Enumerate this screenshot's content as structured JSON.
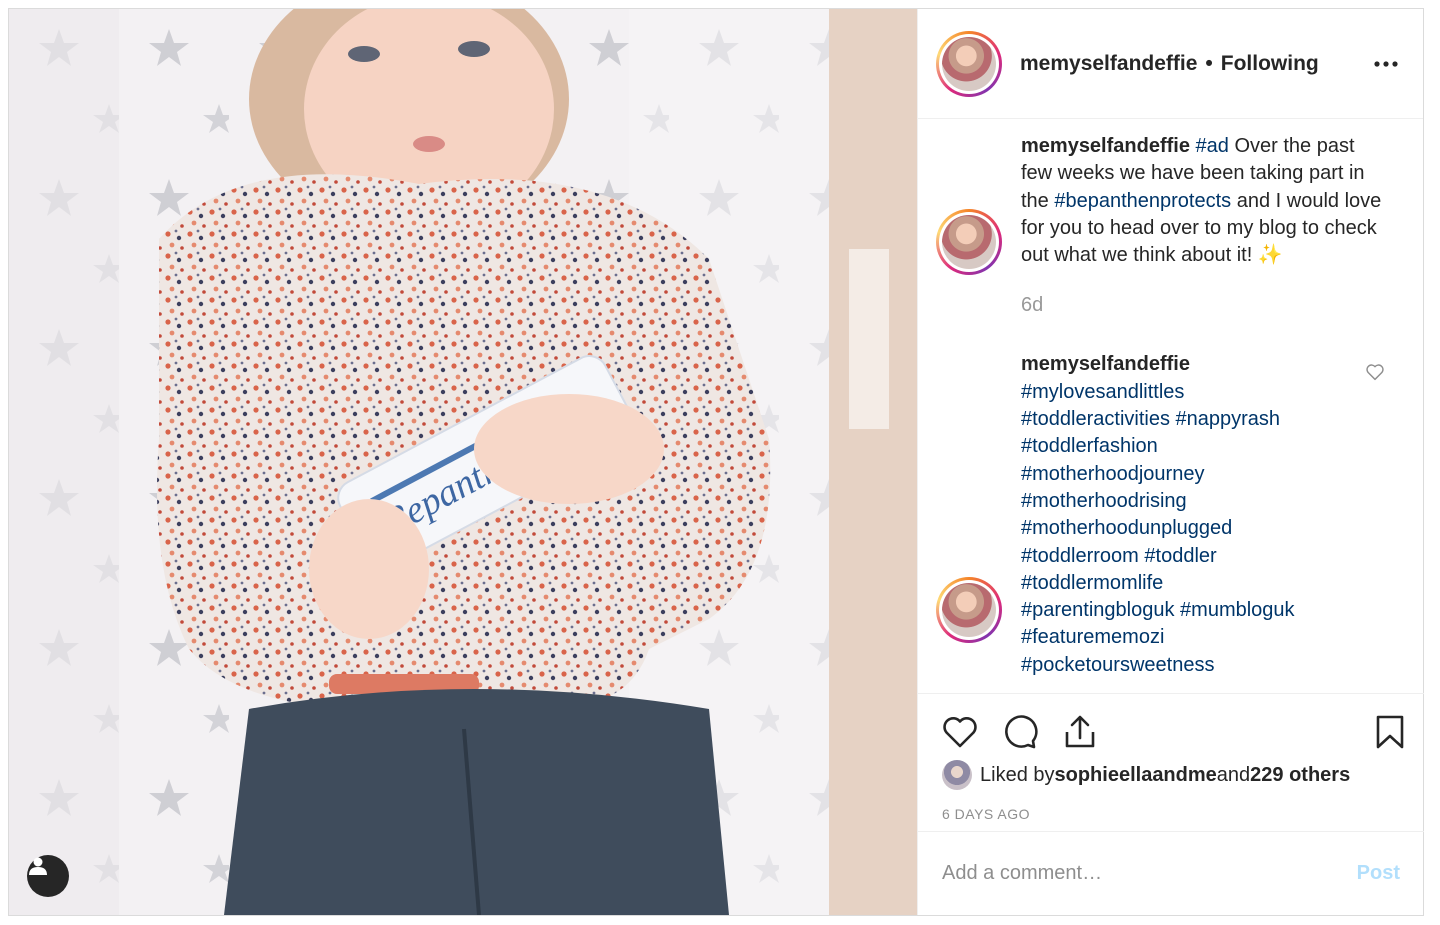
{
  "post": {
    "username": "memyselfandeffie",
    "follow_status": "Following",
    "separator": "•",
    "more_icon": "more-horizontal-icon"
  },
  "caption": {
    "username": "memyselfandeffie",
    "hashtag_ad": "#ad",
    "text_1": " Over the past few weeks we have been taking part in the ",
    "hashtag_campaign": "#bepanthenprotects",
    "text_2": " and I would love for you to head over to my blog to check out what we think about it! ",
    "emoji": "✨",
    "time": "6d"
  },
  "hashtag_comment": {
    "username": "memyselfandeffie",
    "tags": [
      "#mylovesandlittles",
      "#toddleractivities",
      "#nappyrash",
      "#toddlerfashion",
      "#motherhoodjourney",
      "#motherhoodrising",
      "#motherhoodunplugged",
      "#toddlerroom",
      "#toddler",
      "#toddlermomlife",
      "#parentingbloguk",
      "#mumbloguk",
      "#featurememozi",
      "#pocketoursweetness"
    ]
  },
  "likes": {
    "prefix": "Liked by ",
    "liker": "sophieellaandme",
    "middle": " and ",
    "others": "229 others"
  },
  "timestamp": "6 DAYS AGO",
  "comment_form": {
    "placeholder": "Add a comment…",
    "post_label": "Post"
  },
  "photo": {
    "product_label": "Bepanthen"
  },
  "colors": {
    "hashtag": "#003569",
    "post_disabled": "#b2dffc",
    "muted": "#8e8e8e"
  }
}
